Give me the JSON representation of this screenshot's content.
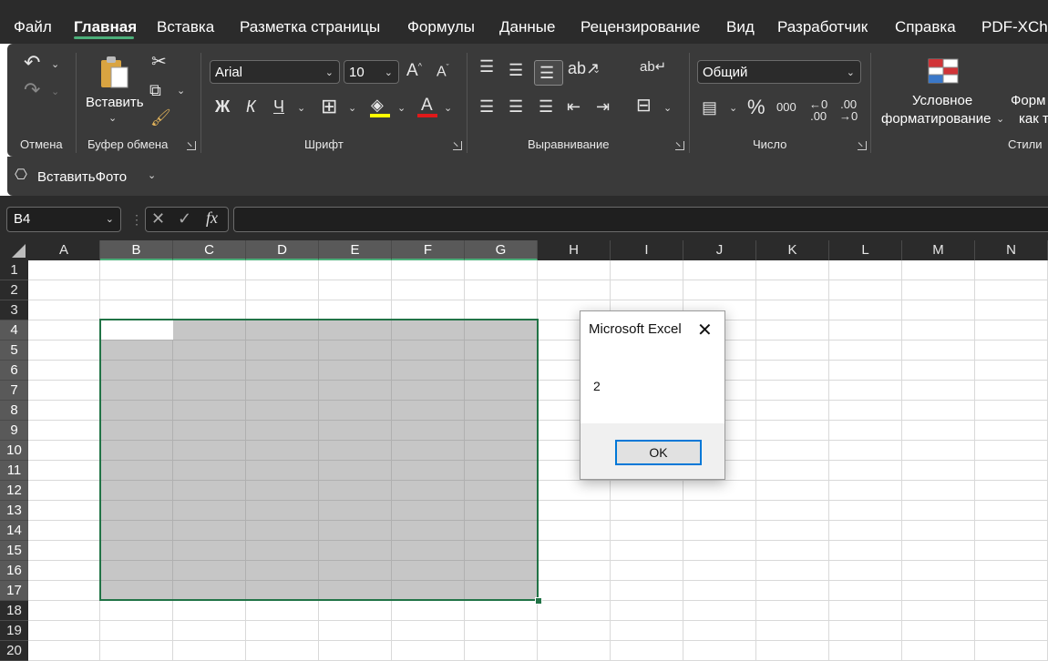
{
  "menu": {
    "tabs": [
      {
        "label": "Файл"
      },
      {
        "label": "Главная",
        "active": true
      },
      {
        "label": "Вставка"
      },
      {
        "label": "Разметка страницы"
      },
      {
        "label": "Формулы"
      },
      {
        "label": "Данные"
      },
      {
        "label": "Рецензирование"
      },
      {
        "label": "Вид"
      },
      {
        "label": "Разработчик"
      },
      {
        "label": "Справка"
      },
      {
        "label": "PDF-XCha"
      }
    ]
  },
  "ribbon": {
    "groups": {
      "undo": "Отмена",
      "clipboard": "Буфер обмена",
      "font": "Шрифт",
      "alignment": "Выравнивание",
      "number": "Число",
      "styles": "Стили"
    },
    "paste_label": "Вставить",
    "font_name": "Arial",
    "font_size": "10",
    "number_format": "Общий",
    "bold": "Ж",
    "italic": "К",
    "underline": "Ч",
    "cond_format_line1": "Условное",
    "cond_format_line2": "форматирование",
    "format_table_line1": "Форм",
    "format_table_line2": "как т",
    "percent": "%",
    "thousands": "000",
    "font_color": "#e0191a",
    "fill_color": "#ffff00"
  },
  "qat": {
    "macro_label": "ВставитьФото"
  },
  "formula_bar": {
    "name_box": "B4",
    "fx": "fx",
    "value": ""
  },
  "grid": {
    "columns": [
      "A",
      "B",
      "C",
      "D",
      "E",
      "F",
      "G",
      "H",
      "I",
      "J",
      "K",
      "L",
      "M",
      "N"
    ],
    "rows": [
      "1",
      "2",
      "3",
      "4",
      "5",
      "6",
      "7",
      "8",
      "9",
      "10",
      "11",
      "12",
      "13",
      "14",
      "15",
      "16",
      "17",
      "18",
      "19",
      "20"
    ],
    "selection": "B4:G17",
    "active_cell": "B4"
  },
  "dialog": {
    "title": "Microsoft Excel",
    "message": "2",
    "ok_label": "OK"
  }
}
